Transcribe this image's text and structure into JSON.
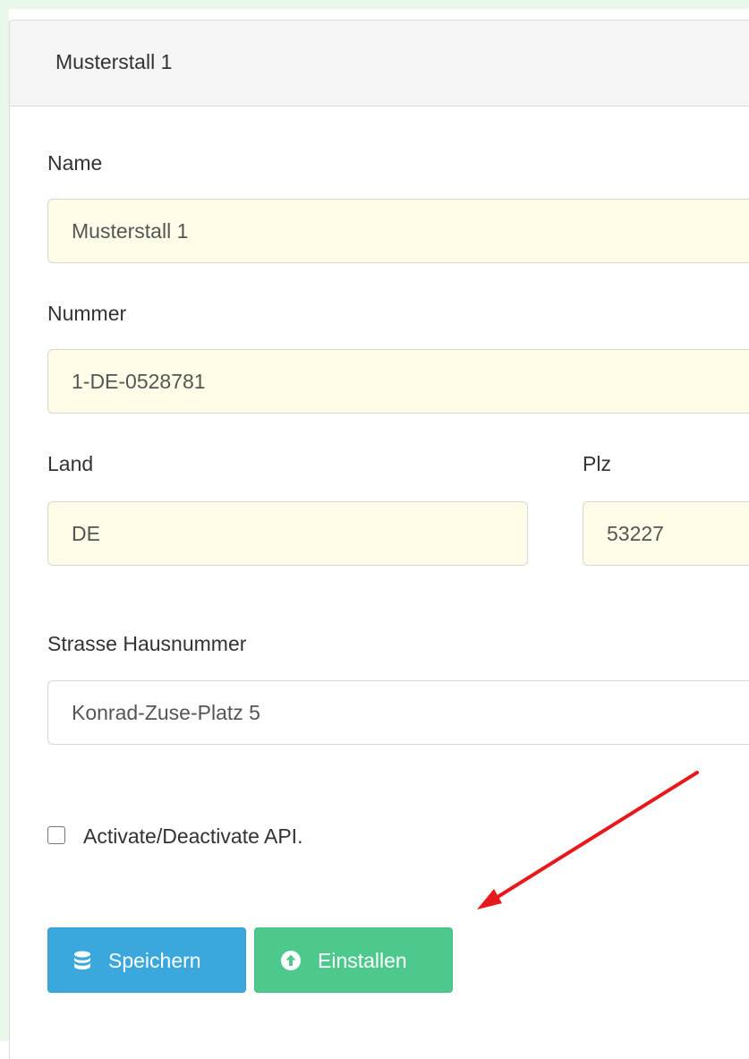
{
  "panel": {
    "title": "Musterstall 1"
  },
  "form": {
    "name": {
      "label": "Name",
      "value": "Musterstall 1"
    },
    "nummer": {
      "label": "Nummer",
      "value": "1-DE-0528781"
    },
    "land": {
      "label": "Land",
      "value": "DE"
    },
    "plz": {
      "label": "Plz",
      "value": "53227"
    },
    "strasse": {
      "label": "Strasse Hausnummer",
      "value": "Konrad-Zuse-Platz 5"
    },
    "api_checkbox": {
      "label": "Activate/Deactivate API.",
      "checked": false
    }
  },
  "buttons": {
    "save": {
      "label": "Speichern",
      "icon": "database-icon",
      "color": "#3aa7dd"
    },
    "install": {
      "label": "Einstallen",
      "icon": "arrow-circle-up-icon",
      "color": "#4ec98e"
    }
  },
  "annotation": {
    "arrow_color": "#e8191c",
    "points_to": "install-button"
  },
  "colors": {
    "autofill_background": "#fffde7",
    "page_accent": "#e9f8ea"
  }
}
